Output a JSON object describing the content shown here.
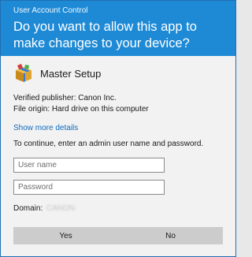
{
  "window": {
    "title": "User Account Control"
  },
  "header": {
    "question": "Do you want to allow this app to make changes to your device?",
    "background_color": "#1e8ad6"
  },
  "app": {
    "name": "Master Setup",
    "icon": "setup-box-icon"
  },
  "details": {
    "publisher": "Verified publisher: Canon Inc.",
    "origin": "File origin: Hard drive on this computer",
    "show_more": "Show more details"
  },
  "instructions": "To continue, enter an admin user name and password.",
  "form": {
    "username_placeholder": "User name",
    "username_value": "",
    "password_placeholder": "Password",
    "password_value": "",
    "domain_label": "Domain:",
    "domain_value": "CANON"
  },
  "buttons": {
    "yes": "Yes",
    "no": "No"
  },
  "colors": {
    "link": "#0f6cbd",
    "button": "#cccccc",
    "border": "#1f6fb2"
  }
}
